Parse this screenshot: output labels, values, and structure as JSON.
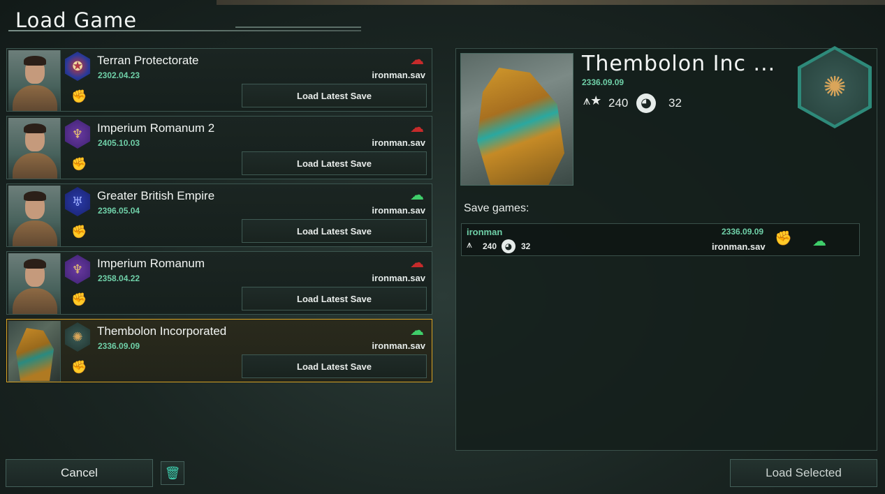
{
  "header": {
    "title": "Load Game"
  },
  "saves": [
    {
      "name": "Terran Protectorate",
      "date": "2302.04.23",
      "file": "ironman.sav",
      "cloud": "cloud-error-icon",
      "emblem": "blue",
      "emblem_glyph": "✪",
      "portrait": "human",
      "load_label": "Load Latest Save"
    },
    {
      "name": "Imperium Romanum 2",
      "date": "2405.10.03",
      "file": "ironman.sav",
      "cloud": "cloud-error-icon",
      "emblem": "purple",
      "emblem_glyph": "♆",
      "portrait": "human",
      "load_label": "Load Latest Save"
    },
    {
      "name": "Greater British Empire",
      "date": "2396.05.04",
      "file": "ironman.sav",
      "cloud": "cloud-upload-icon",
      "emblem": "navy",
      "emblem_glyph": "♅",
      "portrait": "human",
      "load_label": "Load Latest Save"
    },
    {
      "name": "Imperium Romanum",
      "date": "2358.04.22",
      "file": "ironman.sav",
      "cloud": "cloud-error-icon",
      "emblem": "purple",
      "emblem_glyph": "♆",
      "portrait": "human",
      "load_label": "Load Latest Save"
    },
    {
      "name": "Thembolon Incorporated",
      "date": "2336.09.09",
      "file": "ironman.sav",
      "cloud": "cloud-upload-icon",
      "emblem": "teal",
      "emblem_glyph": "✺",
      "portrait": "alien",
      "load_label": "Load Latest Save",
      "selected": true
    }
  ],
  "detail": {
    "name": "Thembolon Inc ...",
    "date": "2336.09.09",
    "rank": "240",
    "planets": "32",
    "saves_label": "Save games:",
    "save_row": {
      "name": "ironman",
      "rank": "240",
      "planets": "32",
      "date": "2336.09.09",
      "file": "ironman.sav"
    }
  },
  "footer": {
    "cancel_label": "Cancel",
    "load_selected_label": "Load Selected"
  },
  "colors": {
    "accent_green": "#6fd0a8",
    "cloud_ok": "#3fce6a",
    "cloud_error": "#c62b2b",
    "selected_border": "#d8a324"
  }
}
